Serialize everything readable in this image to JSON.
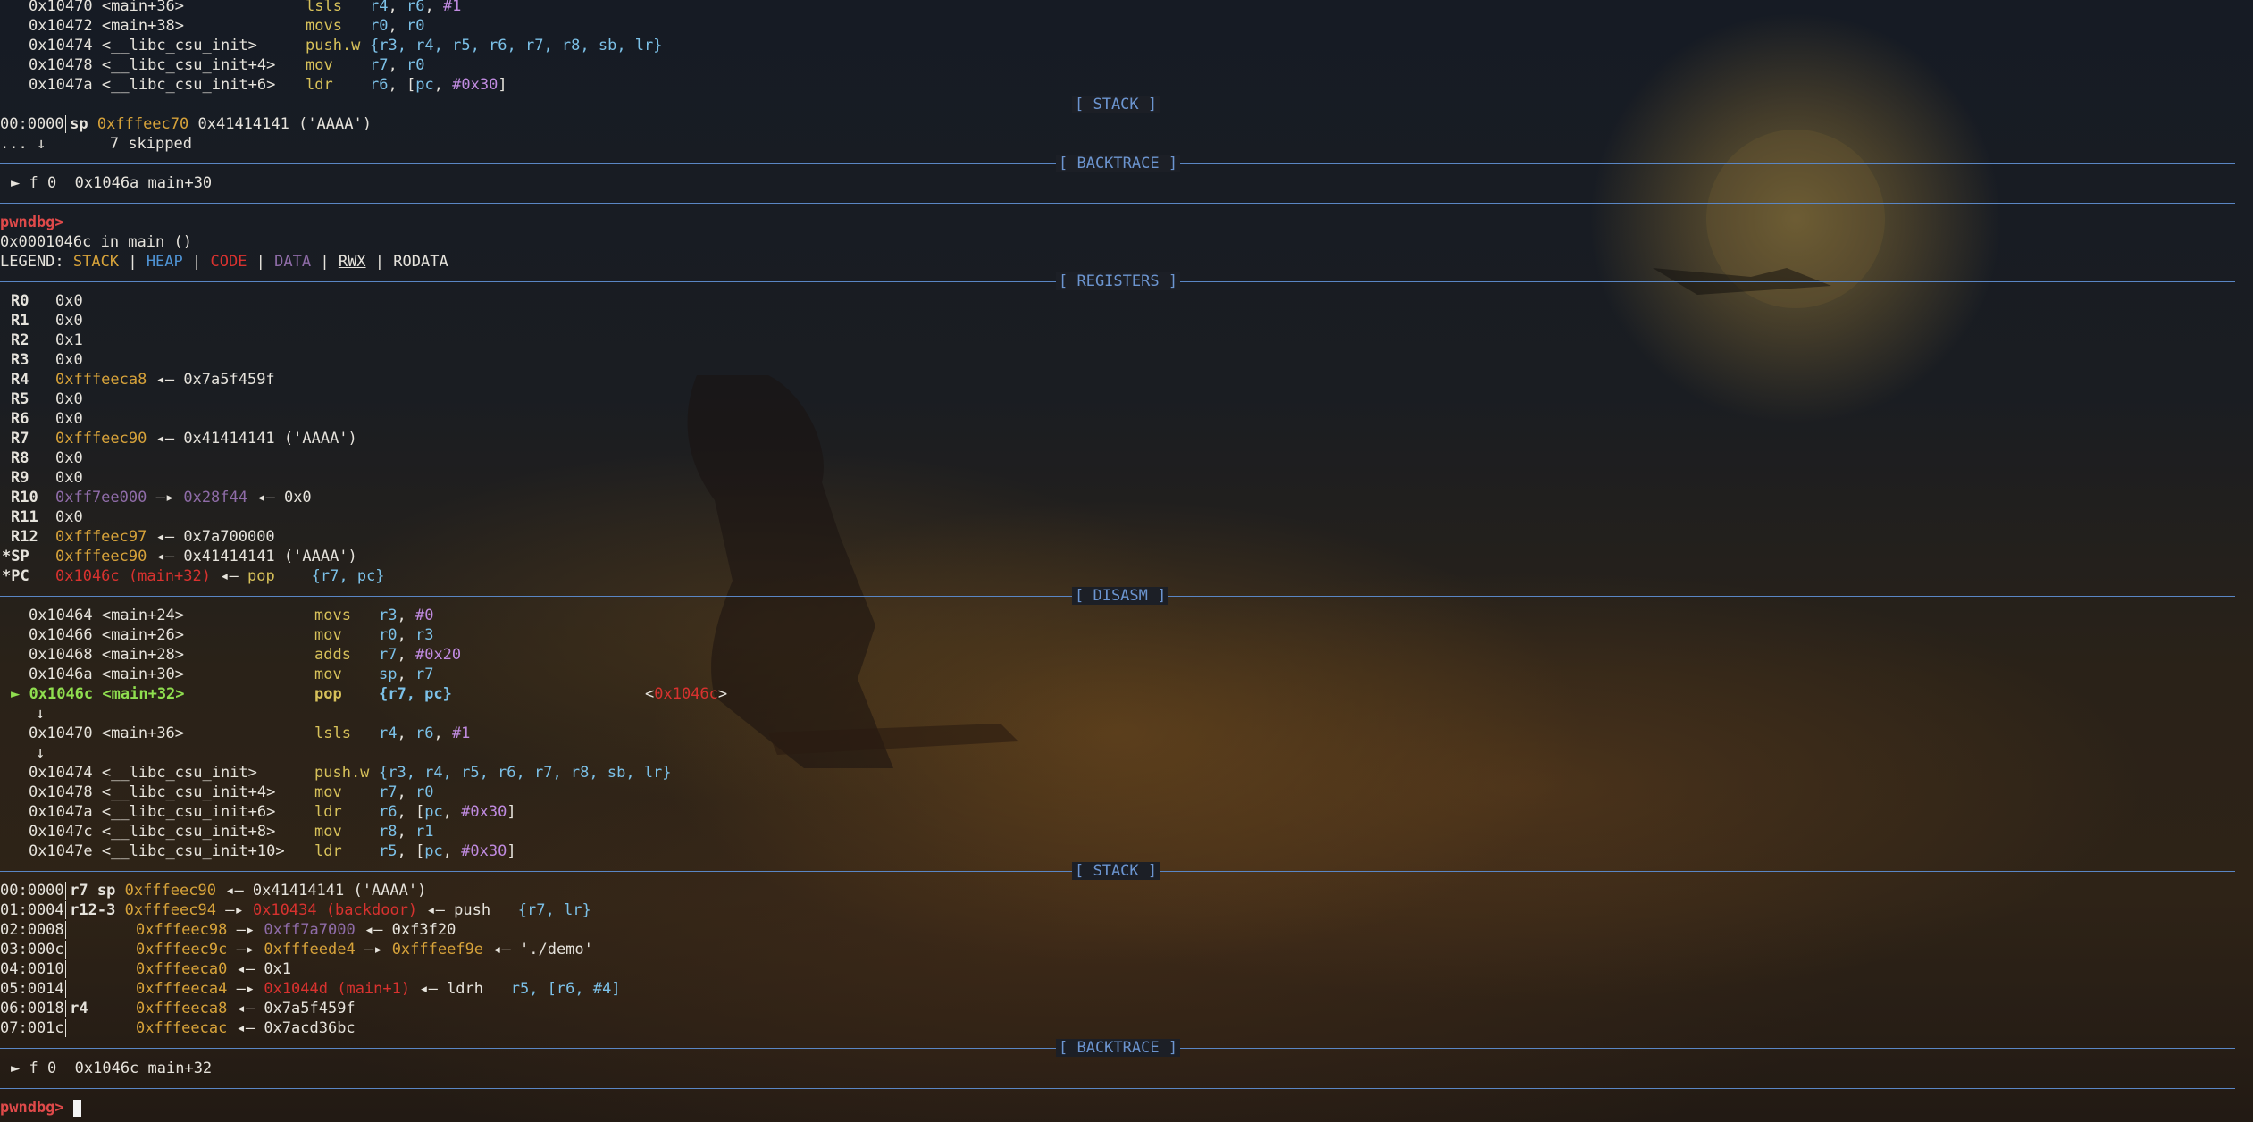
{
  "prompt": "pwndbg>",
  "sections": {
    "stack": "[ STACK ]",
    "backtrace": "[ BACKTRACE ]",
    "registers": "[ REGISTERS ]",
    "disasm": "[ DISASM ]"
  },
  "top_disasm": [
    {
      "addr": "0x10470",
      "sym": "<main+36>",
      "mn": "lsls",
      "ops": [
        "r4",
        "r6",
        "#1"
      ]
    },
    {
      "addr": "0x10472",
      "sym": "<main+38>",
      "mn": "movs",
      "ops": [
        "r0",
        "r0"
      ]
    },
    {
      "addr": "0x10474",
      "sym": "<__libc_csu_init>",
      "mn": "push.w",
      "ops_text": "{r3, r4, r5, r6, r7, r8, sb, lr}"
    },
    {
      "addr": "0x10478",
      "sym": "<__libc_csu_init+4>",
      "mn": "mov",
      "ops": [
        "r7",
        "r0"
      ]
    },
    {
      "addr": "0x1047a",
      "sym": "<__libc_csu_init+6>",
      "mn": "ldr",
      "ops_text": "r6, [pc, #0x30]"
    }
  ],
  "top_stack": {
    "row0_off": "00:0000",
    "row0_reg": "sp",
    "row0_addr": "0xfffeec70",
    "row0_val": "0x41414141 ('AAAA')",
    "skip_prefix": "... ↓",
    "skip_text": "7 skipped"
  },
  "top_backtrace": "► f 0  0x1046a main+30",
  "status_line": "0x0001046c in main ()",
  "legend": {
    "label": "LEGEND:",
    "stack": "STACK",
    "heap": "HEAP",
    "code": "CODE",
    "data": "DATA",
    "rwx": "RWX",
    "rodata": "RODATA"
  },
  "registers": [
    {
      "name": "R0",
      "val": "0x0"
    },
    {
      "name": "R1",
      "val": "0x0"
    },
    {
      "name": "R2",
      "val": "0x1"
    },
    {
      "name": "R3",
      "val": "0x0"
    },
    {
      "name": "R4",
      "val": "0xfffeeca8",
      "tail": "◂— 0x7a5f459f"
    },
    {
      "name": "R5",
      "val": "0x0"
    },
    {
      "name": "R6",
      "val": "0x0"
    },
    {
      "name": "R7",
      "val": "0xfffeec90",
      "tail": "◂— 0x41414141 ('AAAA')"
    },
    {
      "name": "R8",
      "val": "0x0"
    },
    {
      "name": "R9",
      "val": "0x0"
    },
    {
      "name": "R10",
      "val": "0xff7ee000",
      "mid": "—▸",
      "val2": "0x28f44",
      "tail": "◂— 0x0"
    },
    {
      "name": "R11",
      "val": "0x0"
    },
    {
      "name": "R12",
      "val": "0xfffeec97",
      "tail": "◂— 0x7a700000"
    },
    {
      "name": "*SP",
      "val": "0xfffeec90",
      "tail": "◂— 0x41414141 ('AAAA')"
    },
    {
      "name": "*PC",
      "val": "0x1046c (main+32)",
      "tail_arrow": "◂—",
      "tail_mn": "pop",
      "tail_ops": "{r7, pc}"
    }
  ],
  "disasm": [
    {
      "addr": "0x10464",
      "sym": "<main+24>",
      "mn": "movs",
      "ops_text": "r3, #0"
    },
    {
      "addr": "0x10466",
      "sym": "<main+26>",
      "mn": "mov",
      "ops_text": "r0, r3"
    },
    {
      "addr": "0x10468",
      "sym": "<main+28>",
      "mn": "adds",
      "ops_text": "r7, #0x20"
    },
    {
      "addr": "0x1046a",
      "sym": "<main+30>",
      "mn": "mov",
      "ops_text": "sp, r7"
    },
    {
      "addr": "0x1046c",
      "sym": "<main+32>",
      "mn": "pop",
      "ops_text": "{r7, pc}",
      "target": "<0x1046c>",
      "current": true,
      "marker": "►"
    },
    {
      "addr": "0x10470",
      "sym": "<main+36>",
      "mn": "lsls",
      "ops_text": "r4, r6, #1"
    },
    {
      "addr": "0x10474",
      "sym": "<__libc_csu_init>",
      "mn": "push.w",
      "ops_text": "{r3, r4, r5, r6, r7, r8, sb, lr}"
    },
    {
      "addr": "0x10478",
      "sym": "<__libc_csu_init+4>",
      "mn": "mov",
      "ops_text": "r7, r0"
    },
    {
      "addr": "0x1047a",
      "sym": "<__libc_csu_init+6>",
      "mn": "ldr",
      "ops_text": "r6, [pc, #0x30]"
    },
    {
      "addr": "0x1047c",
      "sym": "<__libc_csu_init+8>",
      "mn": "mov",
      "ops_text": "r8, r1"
    },
    {
      "addr": "0x1047e",
      "sym": "<__libc_csu_init+10>",
      "mn": "ldr",
      "ops_text": "r5, [pc, #0x30]"
    }
  ],
  "down_arrow": "↓",
  "stack": [
    {
      "off": "00:0000",
      "regs": "r7 sp",
      "addr": "0xfffeec90",
      "rest": "◂— 0x41414141 ('AAAA')"
    },
    {
      "off": "01:0004",
      "regs": "r12-3",
      "addr": "0xfffeec94",
      "arrow": "—▸",
      "code": "0x10434 (backdoor)",
      "rest2": "◂— push",
      "ops": "{r7, lr}"
    },
    {
      "off": "02:0008",
      "regs": "",
      "addr": "0xfffeec98",
      "arrow": "—▸",
      "data": "0xff7a7000",
      "rest": "◂— 0xf3f20"
    },
    {
      "off": "03:000c",
      "regs": "",
      "addr": "0xfffeec9c",
      "arrow": "—▸",
      "stk2": "0xfffeede4",
      "arrow2": "—▸",
      "stk3": "0xfffeef9e",
      "rest": "◂— './demo'"
    },
    {
      "off": "04:0010",
      "regs": "",
      "addr": "0xfffeeca0",
      "rest": "◂— 0x1"
    },
    {
      "off": "05:0014",
      "regs": "",
      "addr": "0xfffeeca4",
      "arrow": "—▸",
      "code": "0x1044d (main+1)",
      "rest2": "◂— ldrh",
      "ops": "r5, [r6, #4]"
    },
    {
      "off": "06:0018",
      "regs": "r4",
      "addr": "0xfffeeca8",
      "rest": "◂— 0x7a5f459f"
    },
    {
      "off": "07:001c",
      "regs": "",
      "addr": "0xfffeecac",
      "rest": "◂— 0x7acd36bc"
    }
  ],
  "backtrace": "► f 0  0x1046c main+32"
}
